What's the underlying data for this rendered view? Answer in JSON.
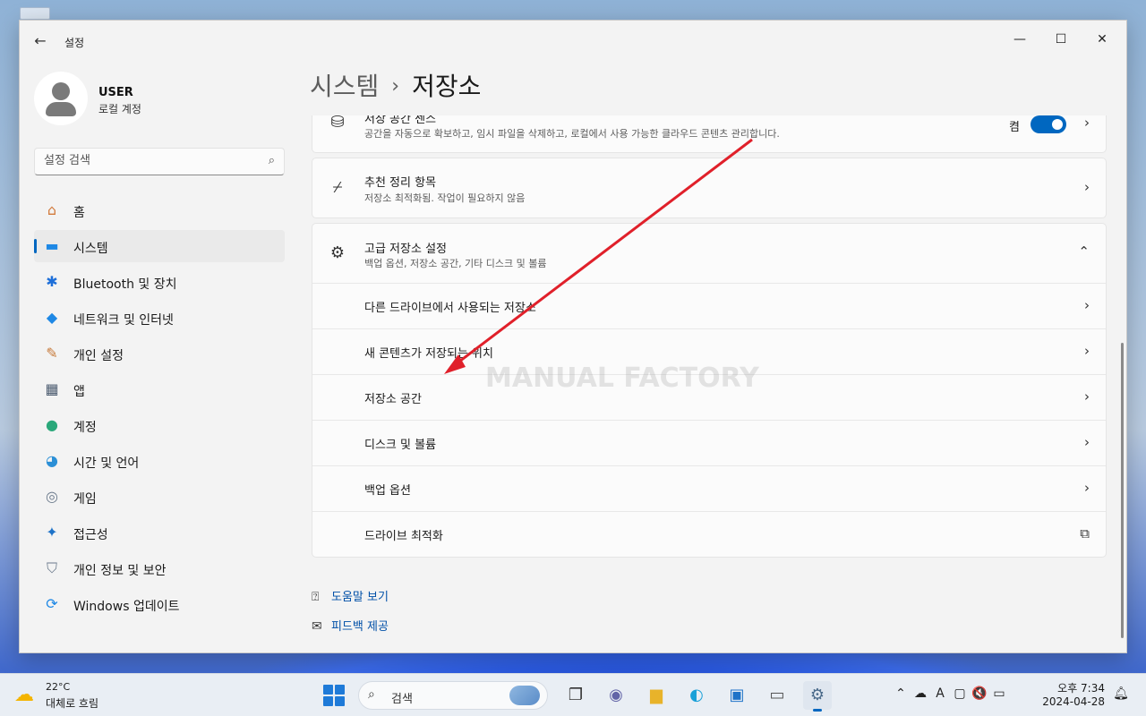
{
  "window": {
    "app_title": "설정",
    "back_icon": "arrow-left-icon",
    "controls": {
      "minimize": "—",
      "maximize": "☐",
      "close": "✕"
    }
  },
  "user": {
    "name": "USER",
    "account_type": "로컬 계정"
  },
  "search": {
    "placeholder": "설정 검색",
    "icon": "⌕"
  },
  "sidebar": {
    "items": [
      {
        "label": "홈",
        "icon": "home-icon",
        "glyph": "⌂",
        "color": "#d27b3d",
        "active": false
      },
      {
        "label": "시스템",
        "icon": "system-icon",
        "glyph": "▬",
        "color": "#1e88e5",
        "active": true
      },
      {
        "label": "Bluetooth 및 장치",
        "icon": "bluetooth-icon",
        "glyph": "✱",
        "color": "#1e6fd9",
        "active": false
      },
      {
        "label": "네트워크 및 인터넷",
        "icon": "wifi-icon",
        "glyph": "◆",
        "color": "#1e88e5",
        "active": false
      },
      {
        "label": "개인 설정",
        "icon": "brush-icon",
        "glyph": "✎",
        "color": "#c77a3a",
        "active": false
      },
      {
        "label": "앱",
        "icon": "apps-icon",
        "glyph": "▦",
        "color": "#4a5a6e",
        "active": false
      },
      {
        "label": "계정",
        "icon": "account-icon",
        "glyph": "●",
        "color": "#2aa87a",
        "active": false
      },
      {
        "label": "시간 및 언어",
        "icon": "globe-clock-icon",
        "glyph": "◕",
        "color": "#2b8fd6",
        "active": false
      },
      {
        "label": "게임",
        "icon": "gamepad-icon",
        "glyph": "◎",
        "color": "#6b7a8c",
        "active": false
      },
      {
        "label": "접근성",
        "icon": "accessibility-icon",
        "glyph": "✦",
        "color": "#1e73c8",
        "active": false
      },
      {
        "label": "개인 정보 및 보안",
        "icon": "shield-icon",
        "glyph": "⛉",
        "color": "#6b7a8c",
        "active": false
      },
      {
        "label": "Windows 업데이트",
        "icon": "update-icon",
        "glyph": "⟳",
        "color": "#1e88e5",
        "active": false
      }
    ]
  },
  "breadcrumb": {
    "parent": "시스템",
    "separator": "›",
    "current": "저장소"
  },
  "main": {
    "storage_sense": {
      "title": "저장 공간 센스",
      "desc": "공간을 자동으로 확보하고, 임시 파일을 삭제하고, 로컬에서 사용 가능한 클라우드 콘텐츠 관리합니다.",
      "toggle_label": "켬",
      "toggle_on": true,
      "icon": "storage-drive-icon"
    },
    "cleanup": {
      "title": "추천 정리 항목",
      "desc": "저장소 최적화됨. 작업이 필요하지 않음",
      "icon": "broom-icon"
    },
    "advanced": {
      "title": "고급 저장소 설정",
      "desc": "백업 옵션, 저장소 공간, 기타 디스크 및 볼륨",
      "icon": "gear-icon",
      "expanded": true,
      "items": [
        {
          "label": "다른 드라이브에서 사용되는 저장소",
          "trail": "›"
        },
        {
          "label": "새 콘텐츠가 저장되는 위치",
          "trail": "›"
        },
        {
          "label": "저장소 공간",
          "trail": "›"
        },
        {
          "label": "디스크 및 볼륨",
          "trail": "›"
        },
        {
          "label": "백업 옵션",
          "trail": "›"
        },
        {
          "label": "드라이브 최적화",
          "trail": "⧉"
        }
      ]
    },
    "links": [
      {
        "label": "도움말 보기",
        "icon": "help-icon"
      },
      {
        "label": "피드백 제공",
        "icon": "feedback-icon"
      }
    ]
  },
  "watermark": "MANUAL FACTORY",
  "taskbar": {
    "weather": {
      "temp": "22°C",
      "desc": "대체로 흐림",
      "icon": "weather-cloud-sun-icon"
    },
    "search_label": "검색",
    "apps": [
      {
        "name": "task-view-icon",
        "glyph": "❐",
        "color": "#333333"
      },
      {
        "name": "teams-icon",
        "glyph": "◉",
        "color": "#6264a7"
      },
      {
        "name": "file-explorer-icon",
        "glyph": "▆",
        "color": "#e8b32a"
      },
      {
        "name": "edge-icon",
        "glyph": "◐",
        "color": "#1aa0d8"
      },
      {
        "name": "store-icon",
        "glyph": "▣",
        "color": "#1e73c8"
      },
      {
        "name": "pc-icon",
        "glyph": "▭",
        "color": "#555555"
      },
      {
        "name": "settings-icon",
        "glyph": "⚙",
        "color": "#4a6a8a"
      }
    ],
    "tray": [
      "chevron-up-icon",
      "cloud-off-icon",
      "ime-icon",
      "display-icon",
      "volume-mute-icon",
      "battery-icon"
    ],
    "tray_glyphs": [
      "⌃",
      "☁",
      "A",
      "▢",
      "🔇",
      "▭"
    ],
    "clock": {
      "time": "오후 7:34",
      "date": "2024-04-28"
    },
    "notification_icon": "bell-icon"
  },
  "colors": {
    "accent": "#0067c0",
    "arrow": "#e0202a"
  }
}
